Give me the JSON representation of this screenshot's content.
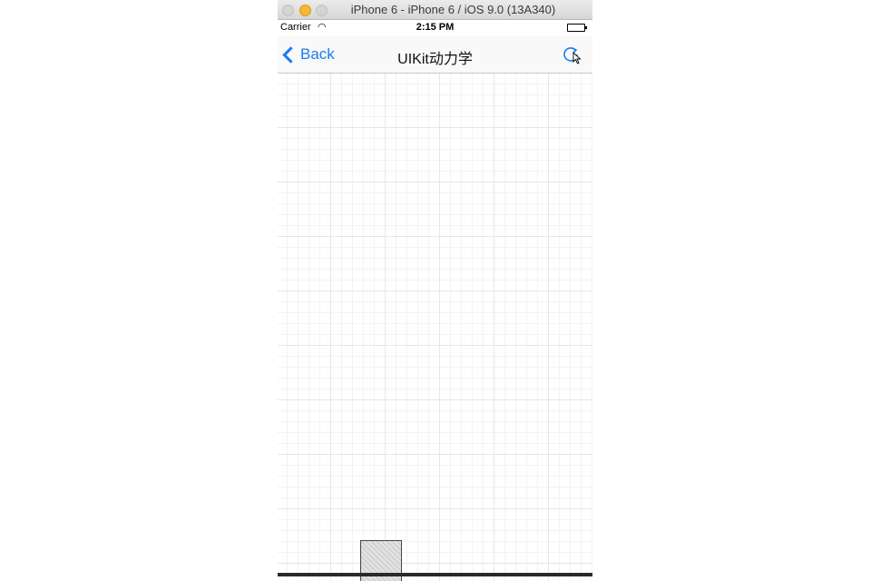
{
  "window": {
    "title": "iPhone 6 - iPhone 6 / iOS 9.0 (13A340)"
  },
  "status_bar": {
    "carrier": "Carrier",
    "time": "2:15 PM",
    "wifi_icon": "wifi-icon",
    "battery_icon": "battery-icon"
  },
  "nav_bar": {
    "back_label": "Back",
    "title": "UIKit动力学",
    "refresh_icon": "refresh-icon"
  },
  "colors": {
    "accent": "#1a7df0",
    "ground": "#2a2a2a",
    "grid": "#e6e6e6"
  }
}
